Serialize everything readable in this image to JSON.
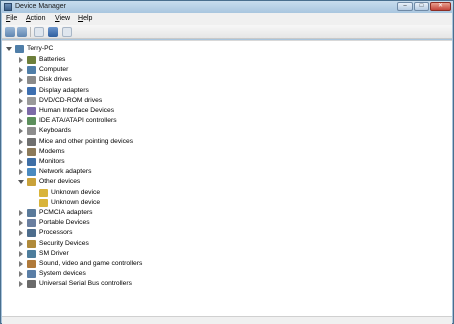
{
  "window": {
    "title": "Device Manager"
  },
  "menu": [
    {
      "u": "F",
      "rest": "ile"
    },
    {
      "u": "A",
      "rest": "ction"
    },
    {
      "u": "V",
      "rest": "iew"
    },
    {
      "u": "H",
      "rest": "elp"
    }
  ],
  "tree": {
    "root": "Terry-PC",
    "items": [
      {
        "label": "Batteries",
        "icon": "battery-icon",
        "color": "#6d7f3a"
      },
      {
        "label": "Computer",
        "icon": "computer-icon",
        "color": "#4f7ea8"
      },
      {
        "label": "Disk drives",
        "icon": "disk-drive-icon",
        "color": "#8a8a8a"
      },
      {
        "label": "Display adapters",
        "icon": "display-adapter-icon",
        "color": "#3d6fb0"
      },
      {
        "label": "DVD/CD-ROM drives",
        "icon": "dvd-drive-icon",
        "color": "#9a9a9a"
      },
      {
        "label": "Human Interface Devices",
        "icon": "hid-icon",
        "color": "#7c6aa8"
      },
      {
        "label": "IDE ATA/ATAPI controllers",
        "icon": "ide-controller-icon",
        "color": "#5c8f5c"
      },
      {
        "label": "Keyboards",
        "icon": "keyboard-icon",
        "color": "#8d8d8d"
      },
      {
        "label": "Mice and other pointing devices",
        "icon": "mouse-icon",
        "color": "#707070"
      },
      {
        "label": "Modems",
        "icon": "modem-icon",
        "color": "#8c7a5a"
      },
      {
        "label": "Monitors",
        "icon": "monitor-icon",
        "color": "#3f6fa6"
      },
      {
        "label": "Network adapters",
        "icon": "network-adapter-icon",
        "color": "#4a8ac0"
      },
      {
        "label": "Other devices",
        "icon": "other-devices-icon",
        "color": "#c9a23a",
        "expanded": true
      },
      {
        "label": "Unknown device",
        "icon": "unknown-device-warning-icon",
        "color": "#d9b43a",
        "child": true
      },
      {
        "label": "Unknown device",
        "icon": "unknown-device-warning-icon",
        "color": "#d9b43a",
        "child": true
      },
      {
        "label": "PCMCIA adapters",
        "icon": "pcmcia-icon",
        "color": "#5a7a9a"
      },
      {
        "label": "Portable Devices",
        "icon": "portable-device-icon",
        "color": "#6a7fa0"
      },
      {
        "label": "Processors",
        "icon": "processor-icon",
        "color": "#4d6d8d"
      },
      {
        "label": "Security Devices",
        "icon": "security-device-icon",
        "color": "#b08a3a"
      },
      {
        "label": "SM Driver",
        "icon": "sm-driver-icon",
        "color": "#4d7d9d"
      },
      {
        "label": "Sound, video and game controllers",
        "icon": "sound-icon",
        "color": "#b07a3a"
      },
      {
        "label": "System devices",
        "icon": "system-device-icon",
        "color": "#5a7ea6"
      },
      {
        "label": "Universal Serial Bus controllers",
        "icon": "usb-icon",
        "color": "#6a6a6a"
      }
    ]
  }
}
